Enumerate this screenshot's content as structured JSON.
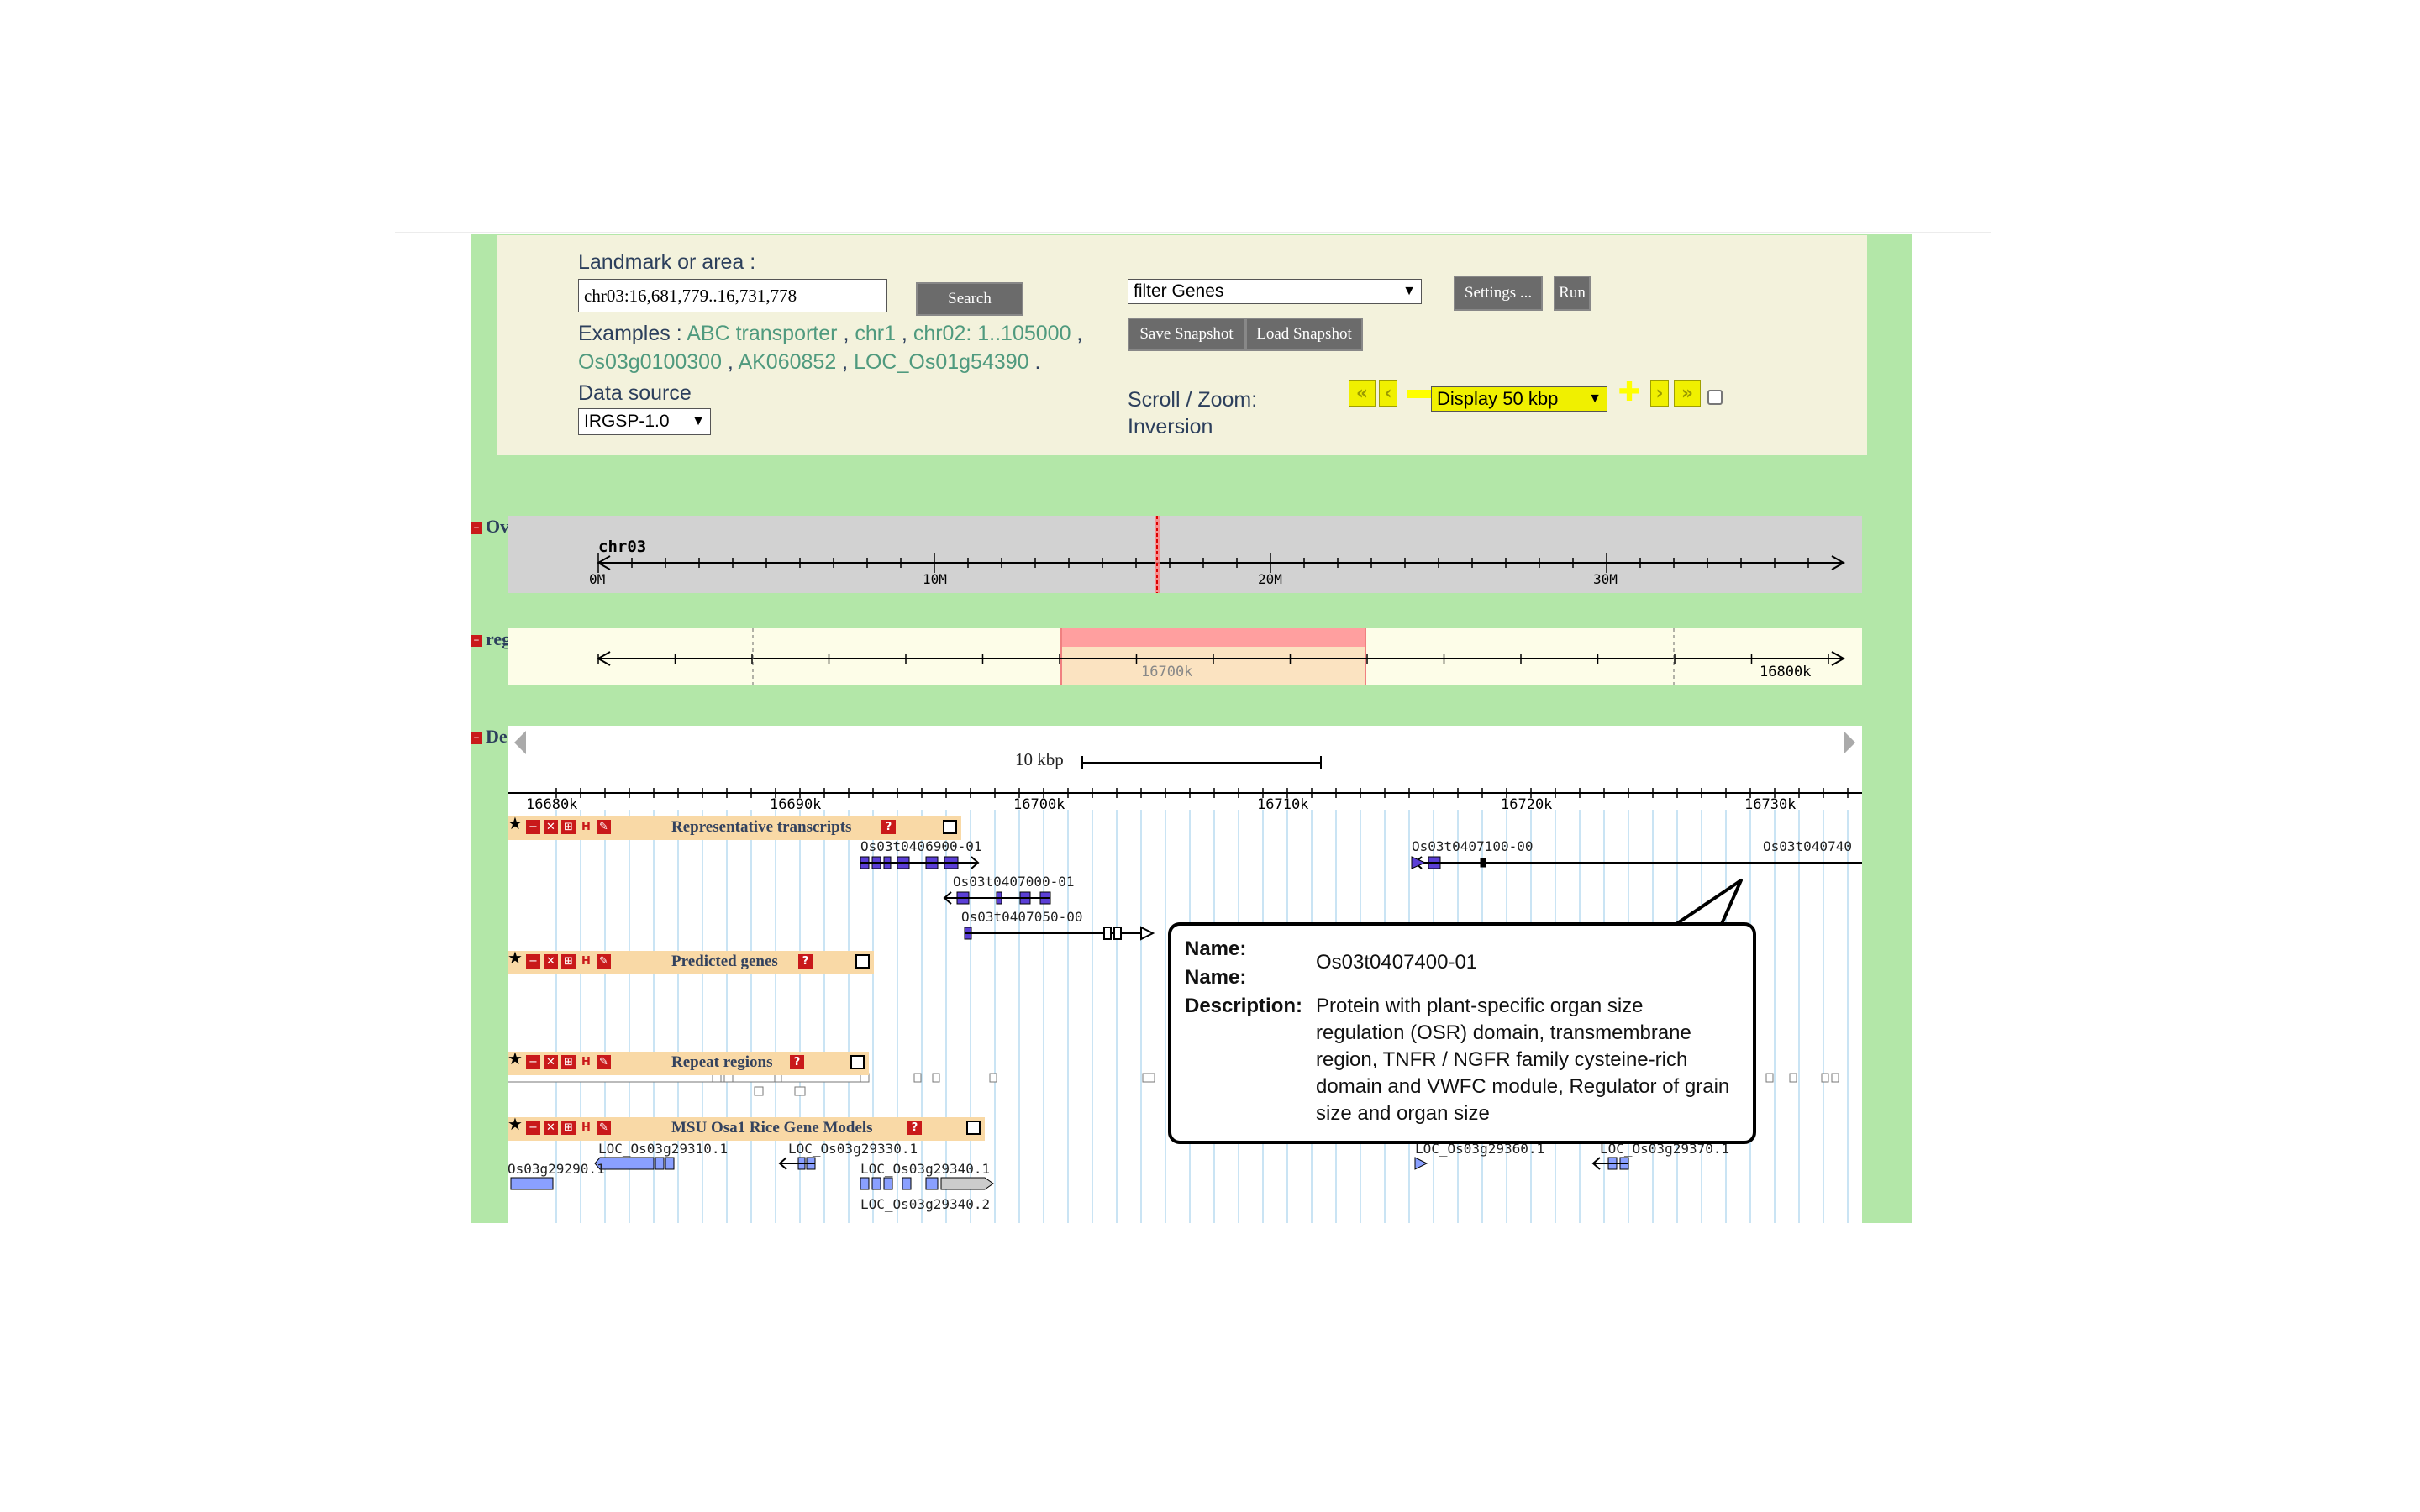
{
  "search": {
    "landmark_label": "Landmark or area",
    "landmark_colon": ":",
    "landmark_value": "chr03:16,681,779..16,731,778",
    "search_button": "Search",
    "examples_label": "Examples",
    "examples_colon": ":",
    "examples": [
      "ABC transporter",
      "chr1",
      "chr02: 1..105000",
      "Os03g0100300",
      "AK060852",
      "LOC_Os01g54390"
    ],
    "datasource_label": "Data source",
    "datasource_value": "IRGSP-1.0"
  },
  "tools": {
    "filter_value": "filter Genes",
    "settings_button": "Settings ...",
    "run_button": "Run",
    "save_snapshot": "Save Snapshot",
    "load_snapshot": "Load Snapshot",
    "scroll_zoom_label": "Scroll / Zoom:",
    "zoom_value": "Display 50 kbp",
    "inversion_label": "Inversion",
    "inversion_checked": false
  },
  "overview": {
    "title": "Overview",
    "chrom": "chr03",
    "ticks": [
      "0M",
      "10M",
      "20M",
      "30M"
    ]
  },
  "region": {
    "title": "region",
    "ticks": [
      "16700k",
      "16800k"
    ]
  },
  "detail": {
    "title": "Detailed view",
    "scale_label": "10 kbp",
    "ticks": [
      "16680k",
      "16690k",
      "16700k",
      "16710k",
      "16720k",
      "16730k"
    ],
    "tracks": {
      "rep": "Representative transcripts",
      "pred": "Predicted genes",
      "repeat": "Repeat regions",
      "msu": "MSU Osa1 Rice Gene Models"
    },
    "genes": {
      "g1": "Os03t0406900-01",
      "g2": "Os03t0407000-01",
      "g3": "Os03t0407050-00",
      "g4": "Os03t0407100-00",
      "g5": "Os03t040740",
      "m1": "LOC_Os03g29310.1",
      "m2": "LOC_Os03g29330.1",
      "m3": "Os03g29290.1",
      "m4": "LOC_Os03g29340.1",
      "m5": "LOC_Os03g29360.1",
      "m6": "LOC_Os03g29370.1",
      "m7": "LOC_Os03g29340.2"
    }
  },
  "popup": {
    "name_key": "Name:",
    "name_key2": "Name:",
    "name_value": "Os03t0407400-01",
    "desc_key": "Description:",
    "desc_value": "Protein with plant-specific organ size regulation (OSR) domain, transmembrane region, TNFR / NGFR family cysteine-rich domain and VWFC module, Regulator of grain size and organ size"
  },
  "colors": {
    "panel_green": "#b3e7a8",
    "search_bg": "#f3f2dc",
    "track_header": "#f9d9a6",
    "gene_blue": "#6a5acd",
    "highlight_red": "#ff9f9f"
  }
}
